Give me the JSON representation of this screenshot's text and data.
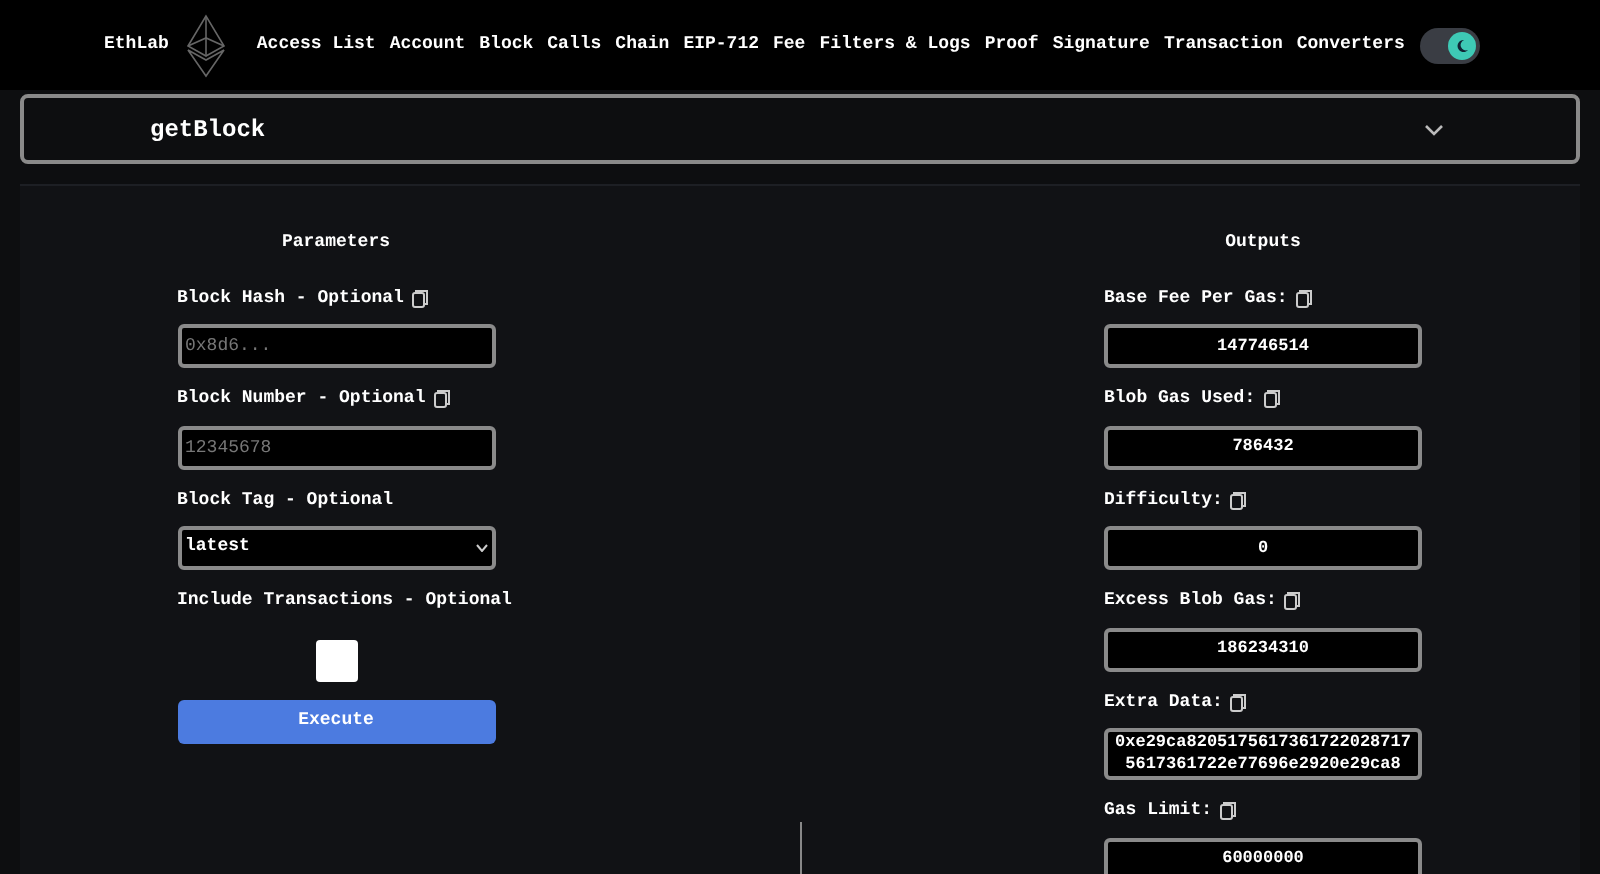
{
  "brand": "EthLab",
  "nav": [
    "Access List",
    "Account",
    "Block",
    "Calls",
    "Chain",
    "EIP-712",
    "Fee",
    "Filters & Logs",
    "Proof",
    "Signature",
    "Transaction",
    "Converters"
  ],
  "theme_toggle": {
    "on": true
  },
  "method_select": {
    "value": "getBlock"
  },
  "parameters": {
    "title": "Parameters",
    "fields": [
      {
        "kind": "text",
        "label": "Block Hash - Optional",
        "copy": true,
        "placeholder": "0x8d6..."
      },
      {
        "kind": "text",
        "label": "Block Number - Optional",
        "copy": true,
        "placeholder": "12345678"
      },
      {
        "kind": "select",
        "label": "Block Tag - Optional",
        "copy": false,
        "value": "latest"
      },
      {
        "kind": "checkbox",
        "label": "Include Transactions - Optional",
        "copy": false,
        "checked": false
      }
    ],
    "button": "Execute"
  },
  "outputs": {
    "title": "Outputs",
    "fields": [
      {
        "label": "Base Fee Per Gas:",
        "value": "147746514"
      },
      {
        "label": "Blob Gas Used:",
        "value": "786432"
      },
      {
        "label": "Difficulty:",
        "value": "0"
      },
      {
        "label": "Excess Blob Gas:",
        "value": "186234310"
      },
      {
        "label": "Extra Data:",
        "value": "0xe29ca82051756173617220287175617361722e77696e2920e29ca8"
      },
      {
        "label": "Gas Limit:",
        "value": "60000000"
      }
    ]
  }
}
